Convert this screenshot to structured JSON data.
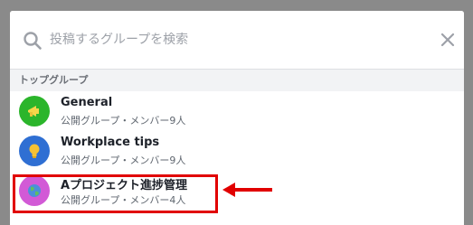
{
  "search": {
    "placeholder": "投稿するグループを検索"
  },
  "section": {
    "title": "トップグループ"
  },
  "groups": [
    {
      "name": "General",
      "meta": "公開グループ・メンバー9人",
      "avatar_color": "#2bb52b",
      "icon": "megaphone-icon"
    },
    {
      "name": "Workplace tips",
      "meta": "公開グループ・メンバー9人",
      "avatar_color": "#2f6fd3",
      "icon": "lightbulb-icon"
    },
    {
      "name": "Aプロジェクト進捗管理",
      "meta": "公開グループ・メンバー4人",
      "avatar_color": "#d25ad6",
      "icon": "globe-icon"
    }
  ],
  "colors": {
    "overlay": "#8a8a8a",
    "annotation_red": "#e10000"
  }
}
